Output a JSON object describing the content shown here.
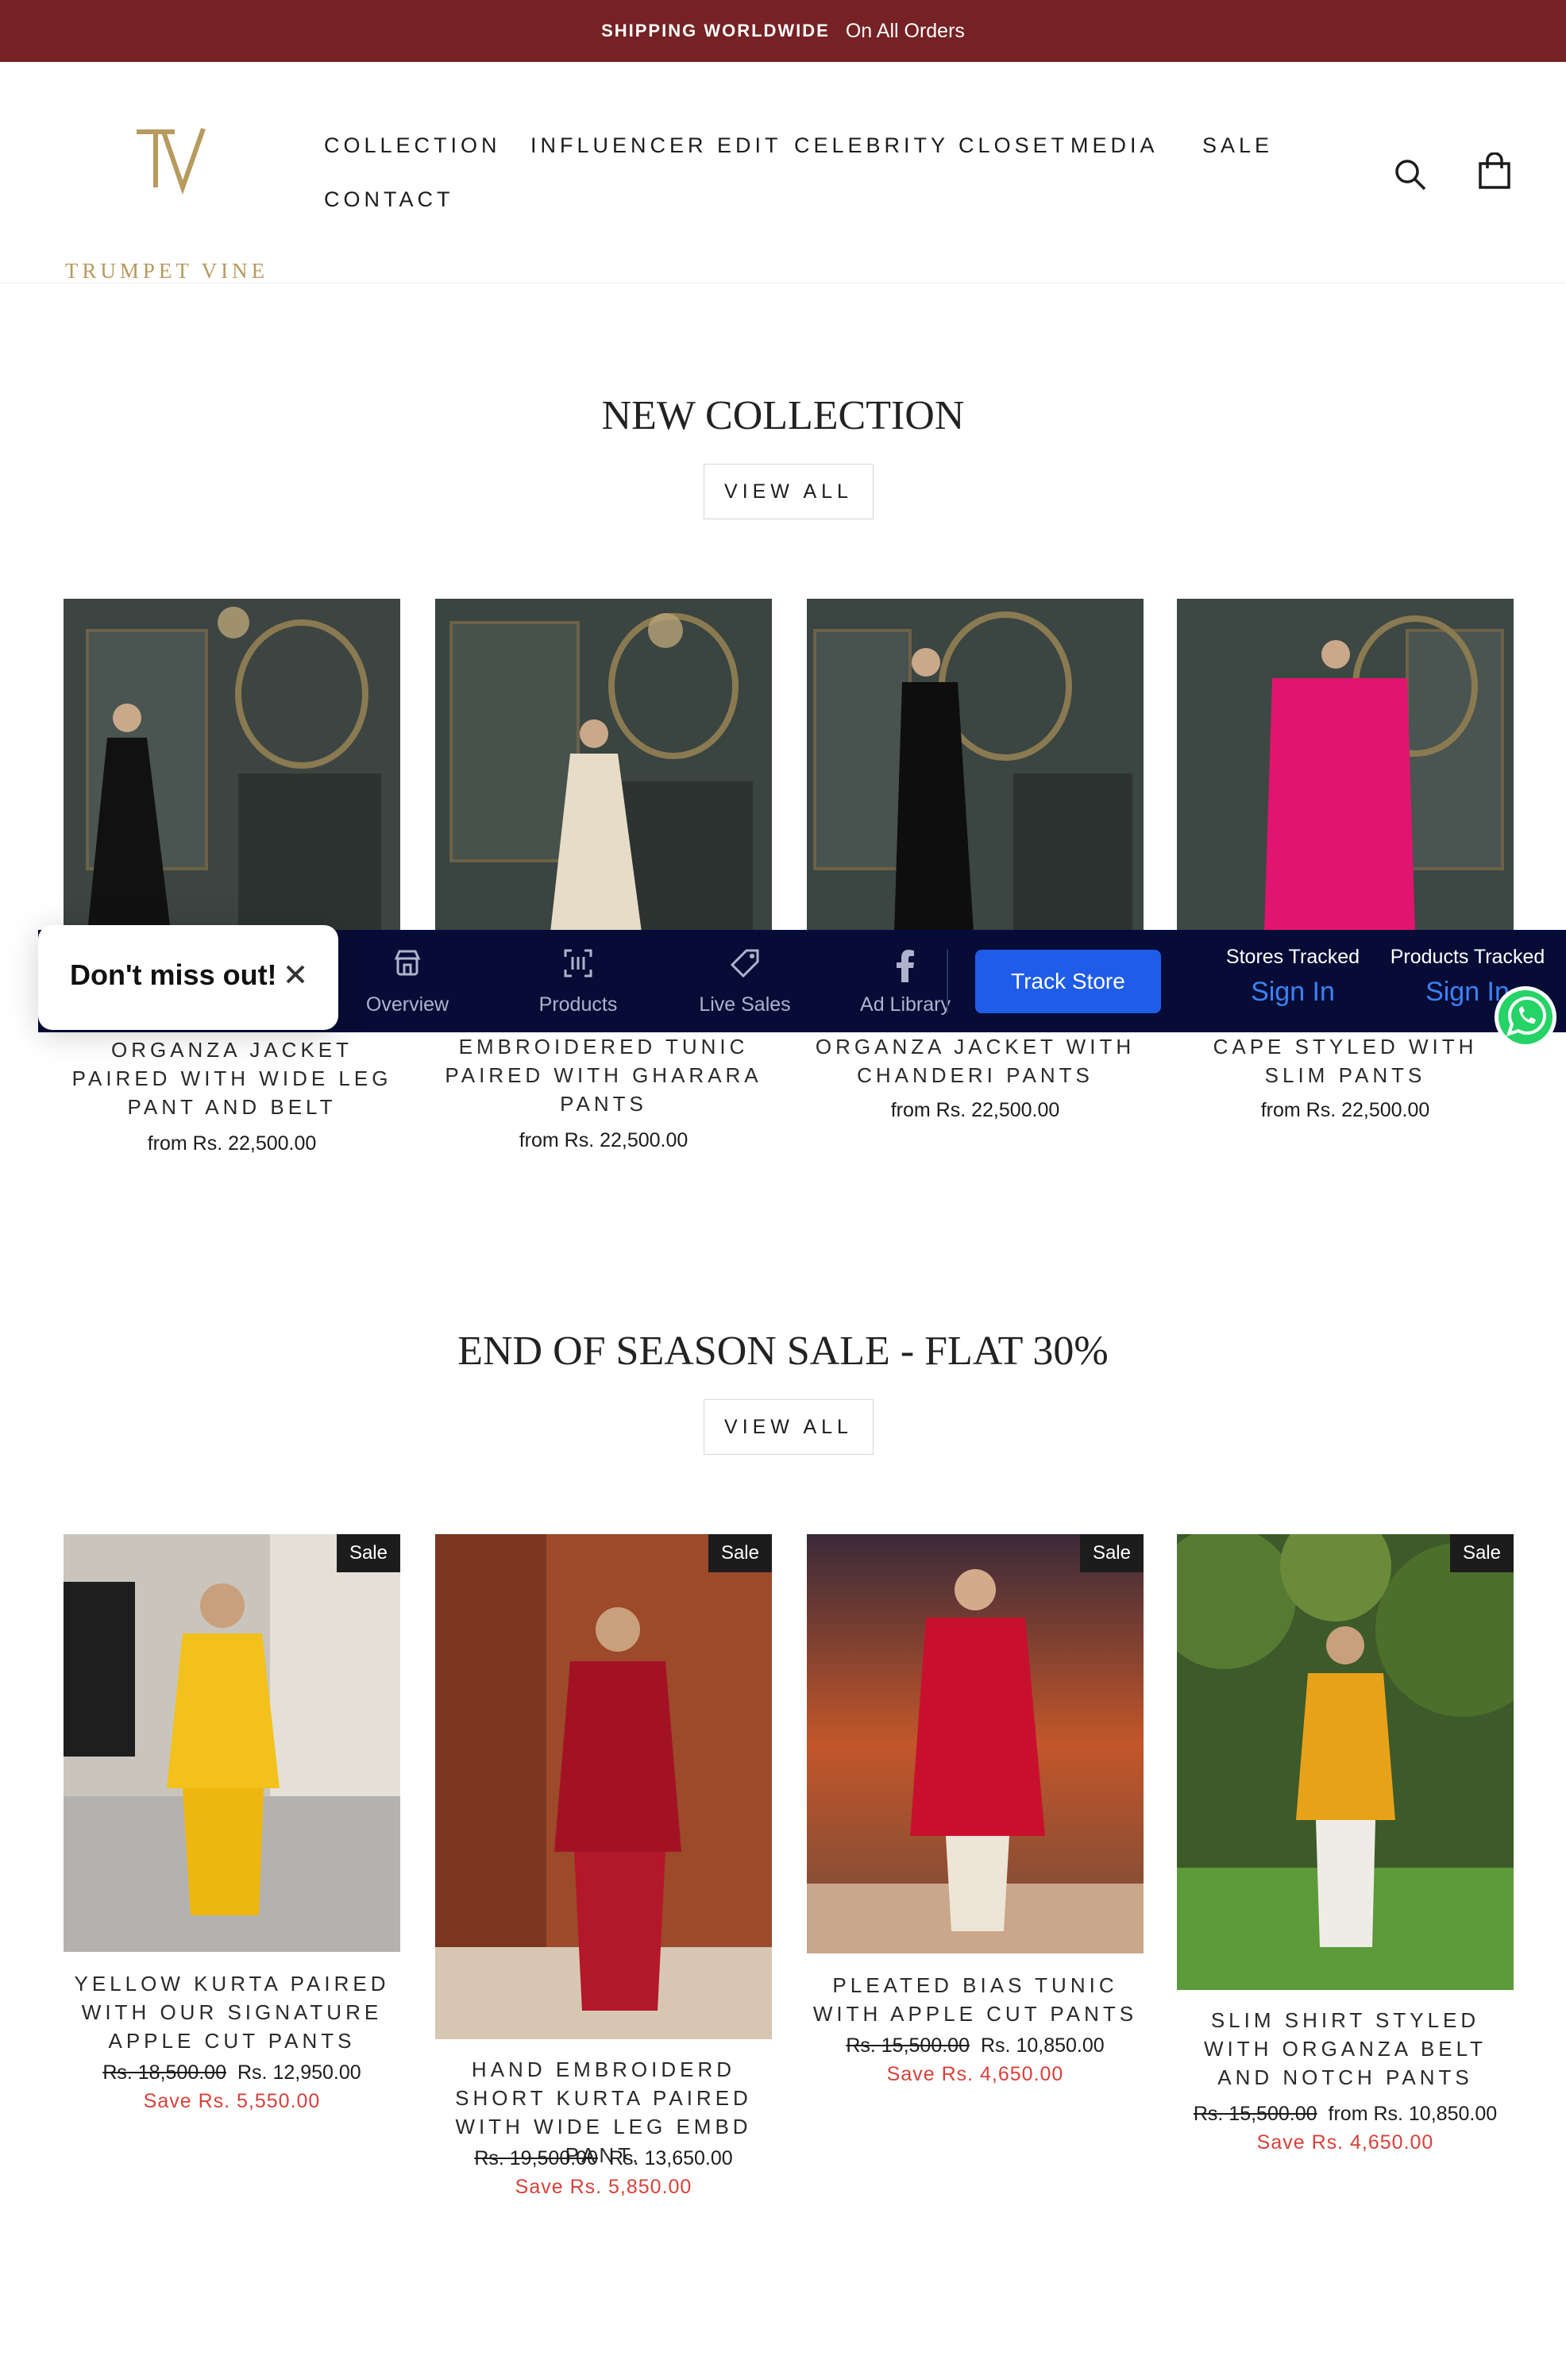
{
  "announcement": {
    "bold": "SHIPPING WORLDWIDE",
    "text": "On All Orders"
  },
  "brand": {
    "name": "TRUMPET VINE",
    "monogram": "TV",
    "gold": "#b79a5d"
  },
  "nav": {
    "items": [
      {
        "label": "COLLECTION"
      },
      {
        "label": "INFLUENCER EDIT"
      },
      {
        "label": "CELEBRITY CLOSET"
      },
      {
        "label": "MEDIA"
      },
      {
        "label": "SALE"
      },
      {
        "label": "CONTACT"
      }
    ],
    "icons": [
      "search-icon",
      "cart-icon"
    ]
  },
  "sections": {
    "new_collection": {
      "title": "NEW COLLECTION",
      "view_all": "VIEW ALL",
      "products": [
        {
          "title": "ORGANZA JACKET PAIRED WITH WIDE LEG PANT AND BELT",
          "price": "from Rs. 22,500.00"
        },
        {
          "title": "EMBROIDERED TUNIC PAIRED WITH GHARARA PANTS",
          "price": "from Rs. 22,500.00"
        },
        {
          "title": "ORGANZA JACKET WITH CHANDERI PANTS",
          "price": "from Rs. 22,500.00"
        },
        {
          "title": "CAPE STYLED WITH SLIM PANTS",
          "price": "from Rs. 22,500.00"
        }
      ]
    },
    "sale": {
      "title": "END OF SEASON SALE - FLAT 30%",
      "view_all": "VIEW ALL",
      "badge": "Sale",
      "products": [
        {
          "title": "YELLOW KURTA PAIRED WITH OUR SIGNATURE APPLE CUT PANTS",
          "old_price": "Rs. 18,500.00",
          "price": "Rs. 12,950.00",
          "save": "Save Rs. 5,550.00"
        },
        {
          "title": "HAND EMBROIDERD SHORT KURTA PAIRED WITH WIDE LEG EMBD PANT.",
          "old_price": "Rs. 19,500.00",
          "price": "Rs. 13,650.00",
          "save": "Save Rs. 5,850.00"
        },
        {
          "title": "PLEATED BIAS TUNIC WITH APPLE CUT PANTS",
          "old_price": "Rs. 15,500.00",
          "price": "Rs. 10,850.00",
          "save": "Save Rs. 4,650.00"
        },
        {
          "title": "SLIM SHIRT STYLED WITH ORGANZA BELT AND NOTCH PANTS",
          "old_price": "Rs. 15,500.00",
          "price": "from Rs. 10,850.00",
          "save": "Save Rs. 4,650.00"
        }
      ]
    }
  },
  "tracker": {
    "tabs": [
      {
        "label": "Overview",
        "icon": "store-icon"
      },
      {
        "label": "Products",
        "icon": "scan-icon"
      },
      {
        "label": "Live Sales",
        "icon": "tag-icon"
      },
      {
        "label": "Ad Library",
        "icon": "facebook-icon"
      }
    ],
    "button": "Track Store",
    "stats": [
      {
        "label": "Stores Tracked",
        "value": "Sign In"
      },
      {
        "label": "Products Tracked",
        "value": "Sign In"
      }
    ]
  },
  "popup": {
    "text": "Don't miss out!"
  },
  "colors": {
    "announcement_bg": "#762124",
    "sale_text": "#d8413a",
    "tracker_bg": "#070c36",
    "track_button": "#1f5ce8"
  }
}
